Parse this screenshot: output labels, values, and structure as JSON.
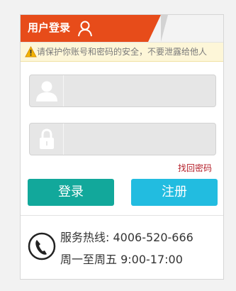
{
  "header": {
    "title": "用户登录",
    "icon": "user-icon",
    "accent_color": "#e74c1a"
  },
  "notice": {
    "icon": "warning-icon",
    "text": "请保护你账号和密码的安全，不要泄露给他人"
  },
  "form": {
    "username": {
      "icon": "user-silhouette-icon",
      "value": "",
      "placeholder": ""
    },
    "password": {
      "icon": "lock-icon",
      "value": "",
      "placeholder": ""
    },
    "forgot_label": "找回密码",
    "login_label": "登录",
    "register_label": "注册",
    "login_color": "#12a89b",
    "register_color": "#22bce0"
  },
  "contact": {
    "icon": "phone-icon",
    "hotline": "服务热线: 4006-520-666",
    "hours": "周一至周五 9:00-17:00"
  }
}
